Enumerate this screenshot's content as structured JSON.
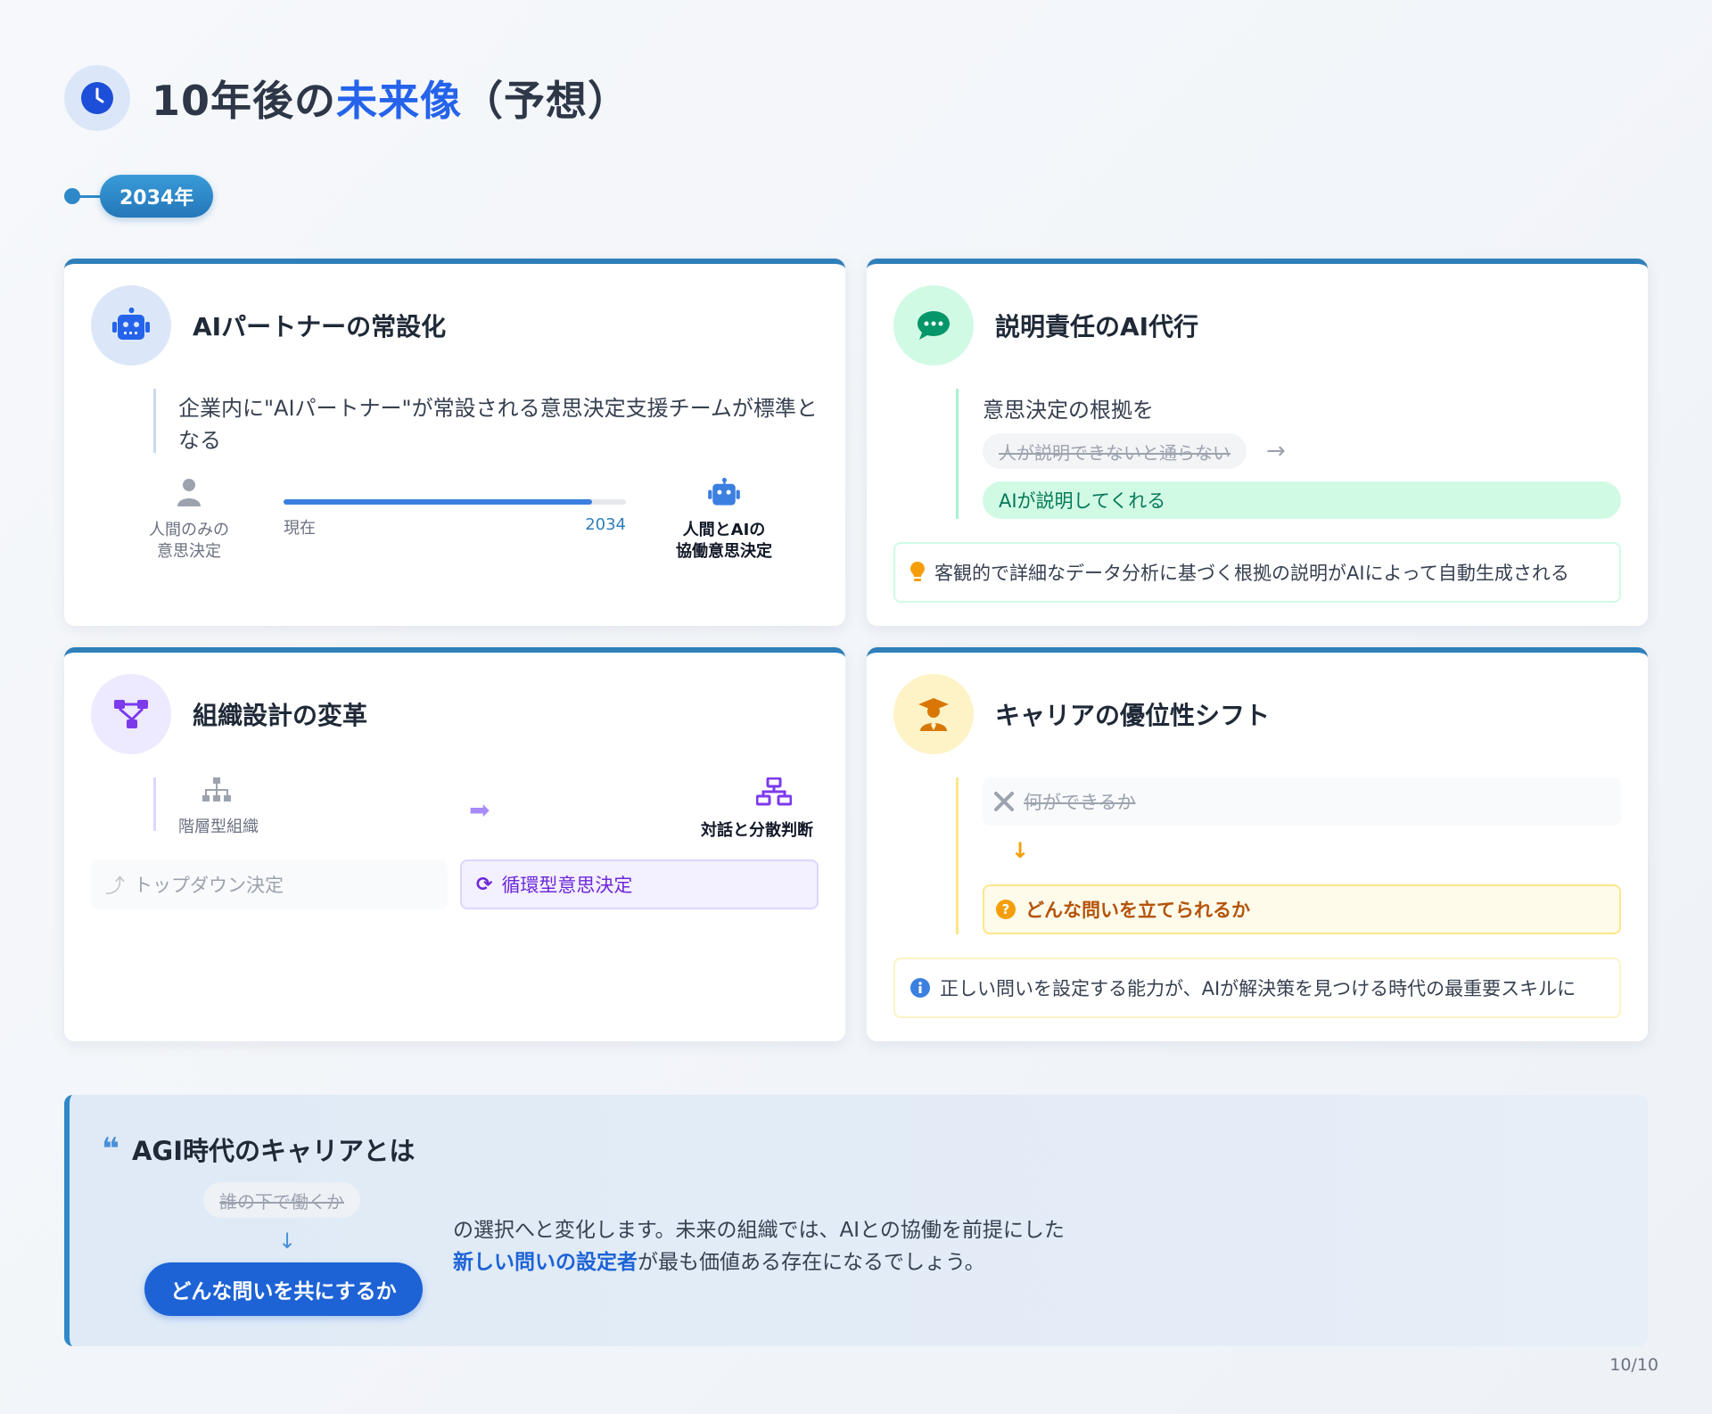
{
  "header": {
    "title_prefix": "10年後の",
    "title_accent": "未来像",
    "title_suffix": "（予想）"
  },
  "year_pill": "2034年",
  "cards": {
    "ai_partner": {
      "title": "AIパートナーの常設化",
      "text": "企業内に\"AIパートナー\"が常設される意思決定支援チームが標準となる",
      "human_label_line1": "人間のみの",
      "human_label_line2": "意思決定",
      "timeline_start": "現在",
      "timeline_end": "2034",
      "timeline_progress": 0.9,
      "ai_label_line1": "人間とAIの",
      "ai_label_line2": "協働意思決定"
    },
    "accountability": {
      "title": "説明責任のAI代行",
      "lead": "意思決定の根拠を",
      "old": "人が説明できないと通らない",
      "new": "AIが説明してくれる",
      "note": "客観的で詳細なデータ分析に基づく根拠の説明がAIによって自動生成される"
    },
    "org_design": {
      "title": "組織設計の変革",
      "from_label": "階層型組織",
      "to_label": "対話と分散判断",
      "old_mode": "トップダウン決定",
      "new_mode": "循環型意思決定"
    },
    "career": {
      "title": "キャリアの優位性シフト",
      "old": "何ができるか",
      "new": "どんな問いを立てられるか",
      "note": "正しい問いを設定する能力が、AIが解決策を見つける時代の最重要スキルに"
    }
  },
  "banner": {
    "title": "AGI時代のキャリアとは",
    "old": "誰の下で働くか",
    "new": "どんな問いを共にするか",
    "text_part1": "の選択へと変化します。未来の組織では、AIとの協働を前提にした",
    "text_highlight": "新しい問いの設定者",
    "text_part2": "が最も価値ある存在になるでしょう。"
  },
  "pager": "10/10",
  "colors": {
    "accent_blue": "#2563eb",
    "card_border": "#2f7fb9",
    "green": "#047857",
    "purple": "#6d28d9",
    "amber": "#b45309"
  }
}
